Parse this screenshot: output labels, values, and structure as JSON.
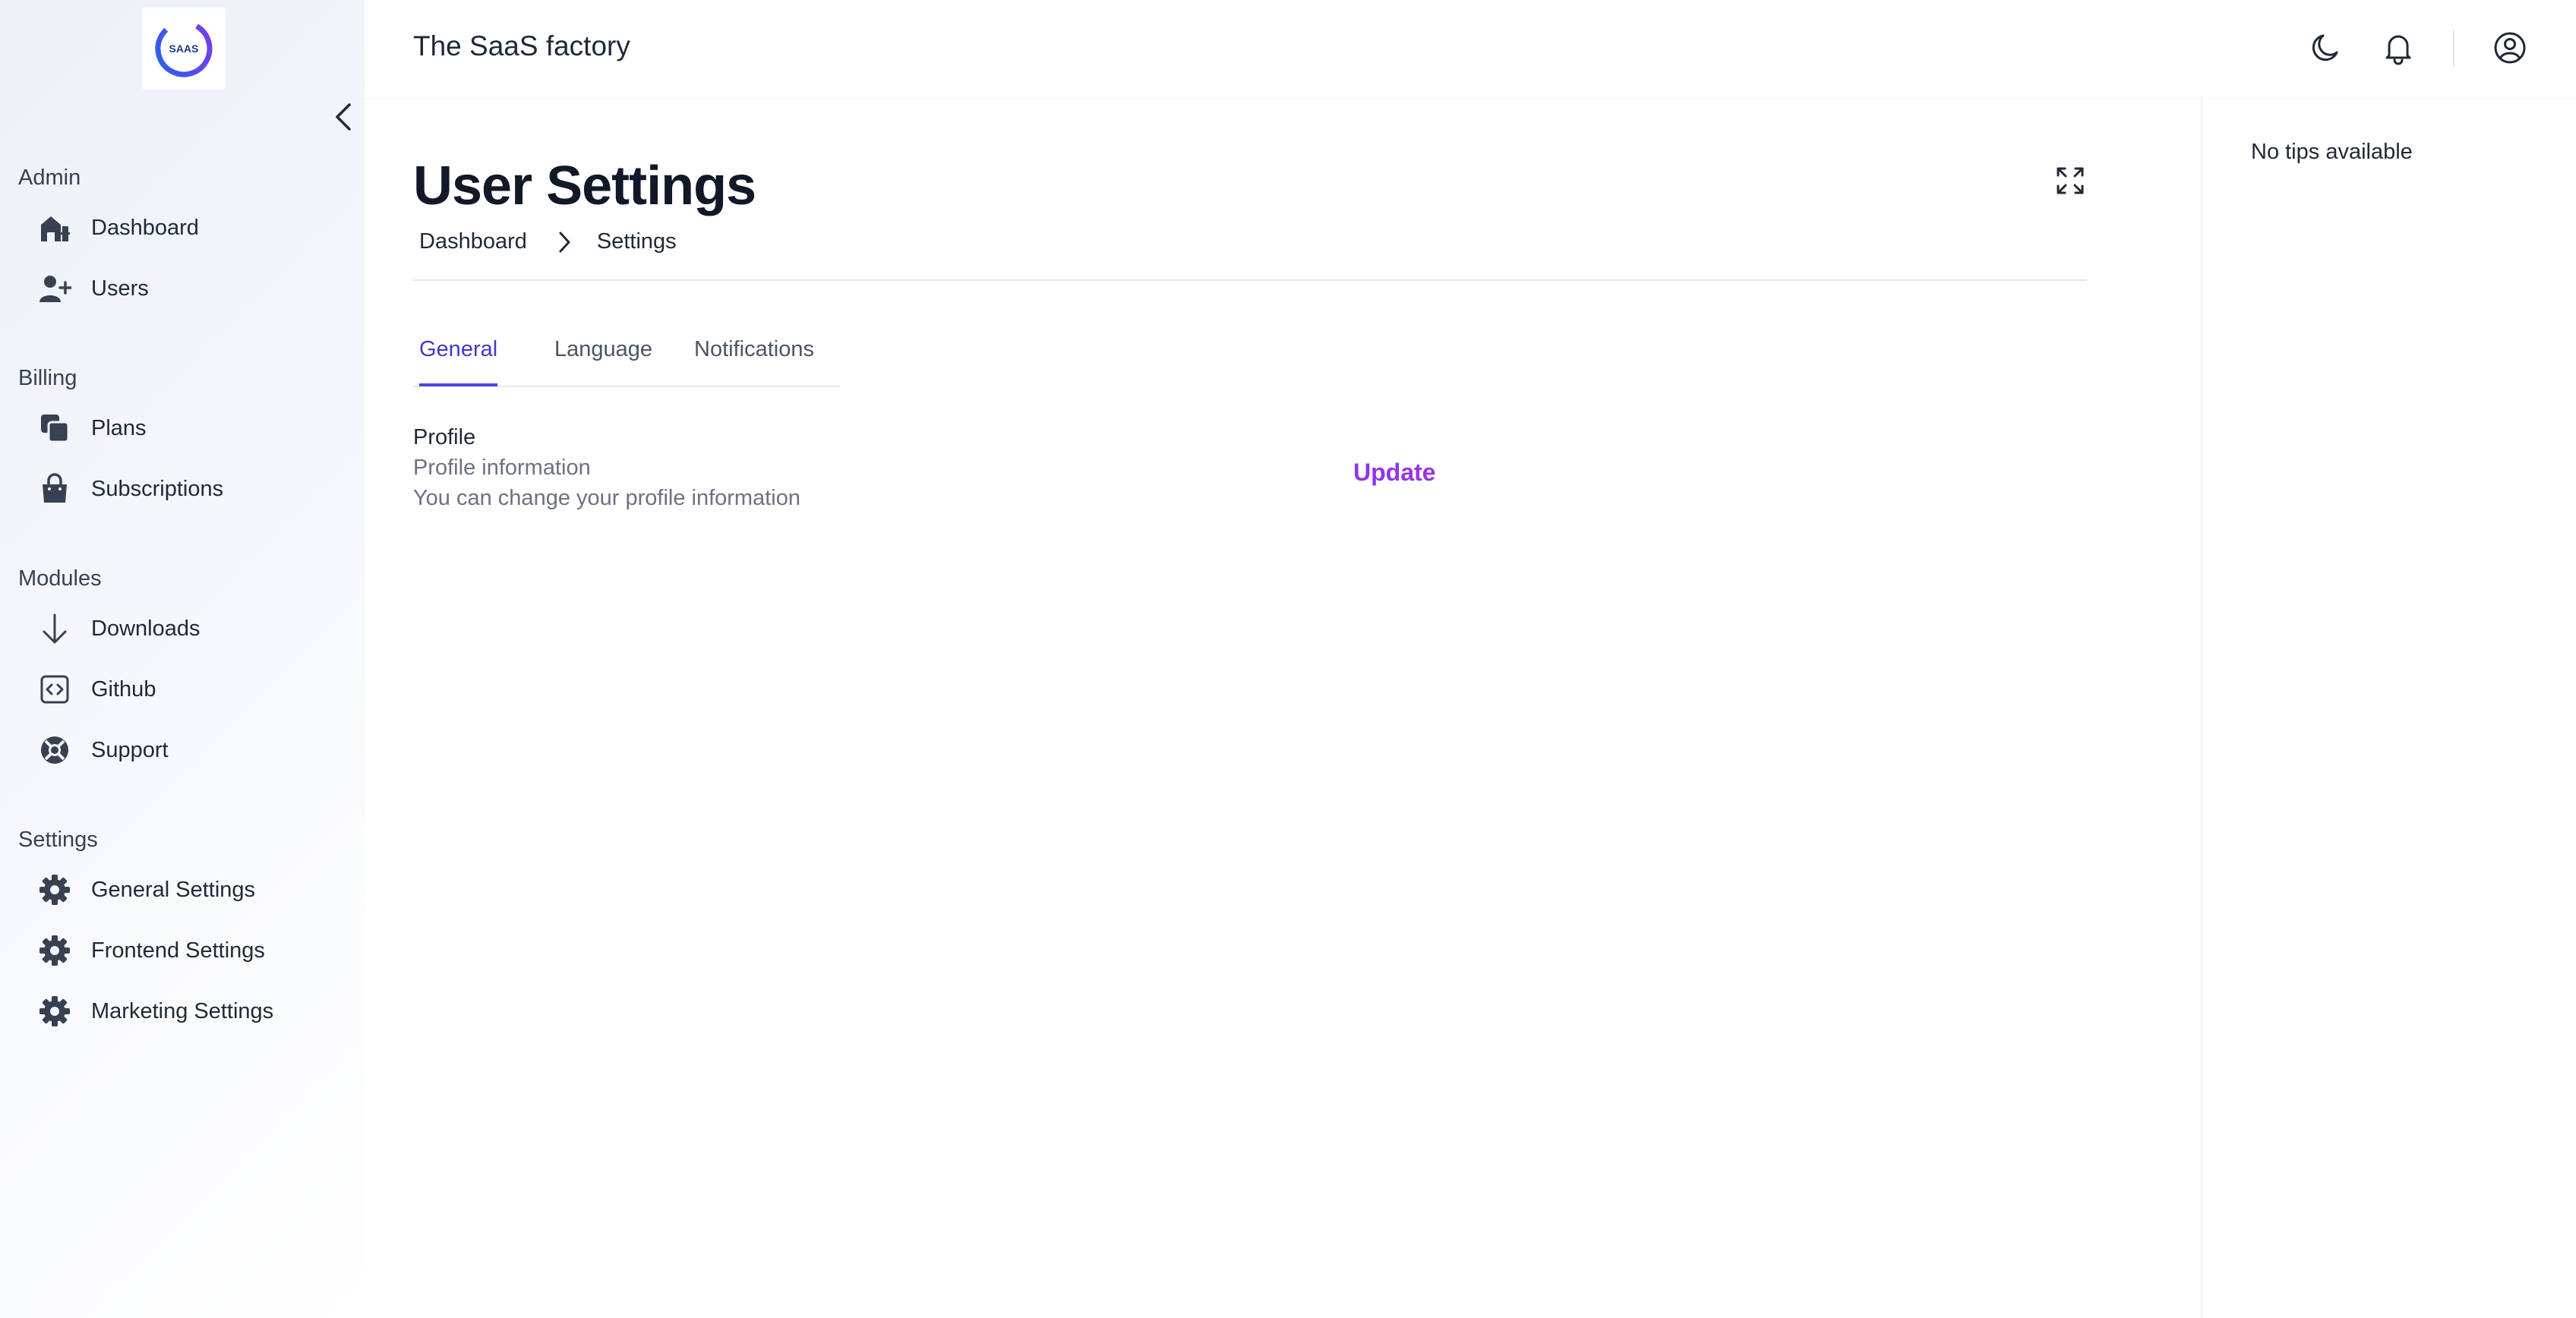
{
  "app": {
    "title": "The SaaS factory",
    "logo_text": "SAAS",
    "accent_color": "#4f46e5",
    "link_color": "#9333ea"
  },
  "sidebar": {
    "sections": [
      {
        "title": "Admin",
        "items": [
          {
            "label": "Dashboard",
            "icon": "home-icon"
          },
          {
            "label": "Users",
            "icon": "user-plus-icon"
          }
        ]
      },
      {
        "title": "Billing",
        "items": [
          {
            "label": "Plans",
            "icon": "copy-icon"
          },
          {
            "label": "Subscriptions",
            "icon": "shopping-bag-icon"
          }
        ]
      },
      {
        "title": "Modules",
        "items": [
          {
            "label": "Downloads",
            "icon": "arrow-down-icon"
          },
          {
            "label": "Github",
            "icon": "code-bracket-icon"
          },
          {
            "label": "Support",
            "icon": "lifebuoy-icon"
          }
        ]
      },
      {
        "title": "Settings",
        "items": [
          {
            "label": "General Settings",
            "icon": "gear-icon"
          },
          {
            "label": "Frontend Settings",
            "icon": "gear-icon"
          },
          {
            "label": "Marketing Settings",
            "icon": "gear-icon"
          }
        ]
      }
    ]
  },
  "header": {
    "icons": [
      "moon-icon",
      "bell-icon",
      "user-circle-icon"
    ]
  },
  "page": {
    "title": "User Settings",
    "breadcrumb": [
      "Dashboard",
      "Settings"
    ],
    "tabs": [
      {
        "label": "General",
        "active": true
      },
      {
        "label": "Language",
        "active": false
      },
      {
        "label": "Notifications",
        "active": false
      }
    ],
    "profile": {
      "title": "Profile",
      "subtitle": "Profile information",
      "description": "You can change your profile information",
      "action_label": "Update"
    }
  },
  "tips": {
    "text": "No tips available"
  }
}
